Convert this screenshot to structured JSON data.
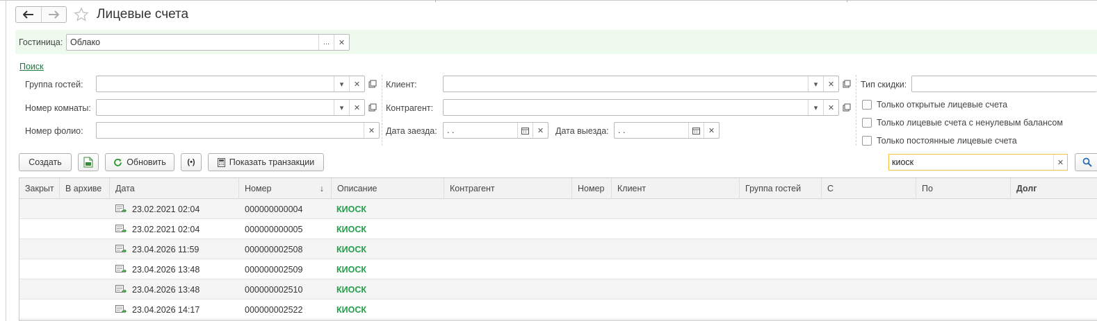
{
  "window": {
    "title": "Лицевые счета"
  },
  "hotel": {
    "label": "Гостиница:",
    "value": "Облако",
    "more_label": "..."
  },
  "search_link": "Поиск",
  "filters": {
    "guest_group": {
      "label": "Группа гостей:",
      "value": ""
    },
    "room_number": {
      "label": "Номер комнаты:",
      "value": ""
    },
    "folio_number": {
      "label": "Номер фолио:",
      "value": ""
    },
    "client": {
      "label": "Клиент:",
      "value": ""
    },
    "counterparty": {
      "label": "Контрагент:",
      "value": ""
    },
    "check_in": {
      "label": "Дата заезда:",
      "value": " .  ."
    },
    "check_out": {
      "label": "Дата выезда:",
      "value": " .  ."
    },
    "discount_type": {
      "label": "Тип скидки:",
      "value": ""
    },
    "checkboxes": [
      {
        "label": "Только открытые лицевые счета",
        "checked": false
      },
      {
        "label": "Только лицевые счета с ненулевым балансом",
        "checked": false
      },
      {
        "label": "Только постоянные лицевые счета",
        "checked": false
      }
    ]
  },
  "toolbar": {
    "create_label": "Создать",
    "refresh_label": "Обновить",
    "show_transactions_label": "Показать транзакции",
    "search_value": "киоск"
  },
  "table": {
    "columns": [
      "Закрыт",
      "В архиве",
      "Дата",
      "Номер",
      "Описание",
      "Контрагент",
      "Номер",
      "Клиент",
      "Группа гостей",
      "С",
      "По",
      "Долг"
    ],
    "sort_indicator": "↓",
    "rows": [
      {
        "date": "23.02.2021 02:04",
        "number": "000000000004",
        "description": "КИОСК"
      },
      {
        "date": "23.02.2021 02:04",
        "number": "000000000005",
        "description": "КИОСК"
      },
      {
        "date": "23.04.2026 11:59",
        "number": "000000002508",
        "description": "КИОСК"
      },
      {
        "date": "23.04.2026 13:48",
        "number": "000000002509",
        "description": "КИОСК"
      },
      {
        "date": "23.04.2026 13:48",
        "number": "000000002510",
        "description": "КИОСК"
      },
      {
        "date": "23.04.2026 14:17",
        "number": "000000002522",
        "description": "КИОСК"
      }
    ]
  },
  "colors": {
    "accent_green": "#22a04a",
    "band_green": "#eefaee",
    "search_border": "#f0c040"
  }
}
